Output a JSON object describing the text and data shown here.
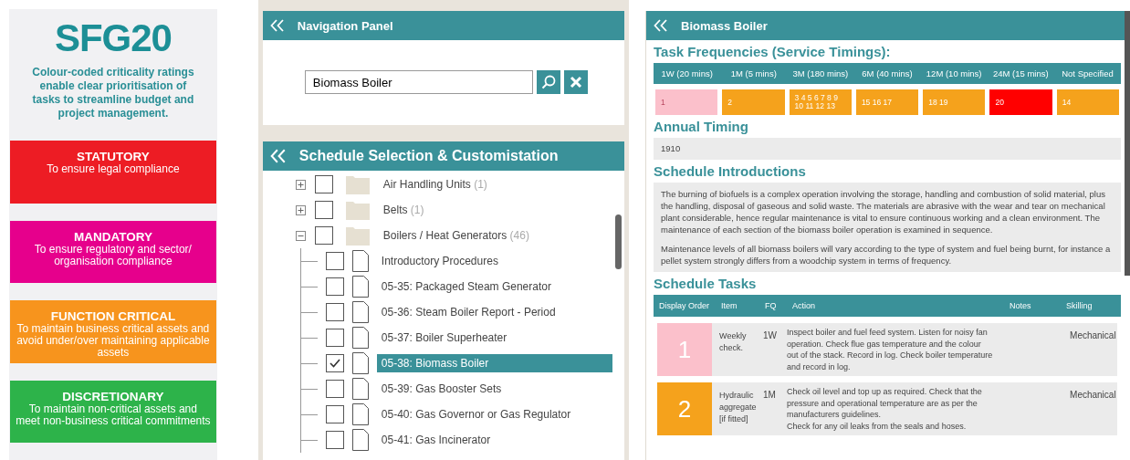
{
  "promo": {
    "logo": "SFG20",
    "tagline": "Colour-coded criticality ratings enable clear prioritisation of tasks to streamline budget and project management.",
    "ratings": [
      {
        "title": "STATUTORY",
        "text": "To ensure legal compliance",
        "color": "#ed1c24"
      },
      {
        "title": "MANDATORY",
        "text": "To ensure regulatory and sector/ organisation compliance",
        "color": "#e6008c"
      },
      {
        "title": "FUNCTION CRITICAL",
        "text": "To maintain business critical assets and avoid under/over maintaining applicable assets",
        "color": "#f7941d"
      },
      {
        "title": "DISCRETIONARY",
        "text": "To maintain non-critical assets and meet non-business critical commitments",
        "color": "#2db34a"
      }
    ]
  },
  "navigation_panel": {
    "title": "Navigation Panel",
    "search": {
      "value": "Biomass Boiler"
    }
  },
  "schedule_panel": {
    "title": "Schedule Selection & Customistation",
    "tree": [
      {
        "label": "Air Handling Units",
        "count": "(1)",
        "expanded": false,
        "checked": false,
        "selected": false
      },
      {
        "label": "Belts",
        "count": "(1)",
        "expanded": false,
        "checked": false,
        "selected": false
      },
      {
        "label": "Boilers / Heat Generators",
        "count": "(46)",
        "expanded": true,
        "checked": false,
        "selected": false,
        "children": [
          {
            "label": "Introductory Procedures",
            "checked": false,
            "selected": false
          },
          {
            "label": "05-35: Packaged Steam Generator",
            "checked": false,
            "selected": false
          },
          {
            "label": "05-36: Steam Boiler Report - Period",
            "checked": false,
            "selected": false
          },
          {
            "label": "05-37: Boiler Superheater",
            "checked": false,
            "selected": false
          },
          {
            "label": "05-38: Biomass Boiler",
            "checked": true,
            "selected": true
          },
          {
            "label": "05-39: Gas Booster Sets",
            "checked": false,
            "selected": false
          },
          {
            "label": "05-40: Gas Governor or Gas Regulator",
            "checked": false,
            "selected": false
          },
          {
            "label": "05-41: Gas Incinerator",
            "checked": false,
            "selected": false
          }
        ]
      }
    ]
  },
  "detail_panel": {
    "title": "Biomass Boiler",
    "frequencies_heading": "Task Frequencies (Service Timings):",
    "frequencies": [
      {
        "label": "1W (20 mins)",
        "tasks": "1",
        "color": "#fbc0cb"
      },
      {
        "label": "1M (5 mins)",
        "tasks": "2",
        "color": "#f5a21c"
      },
      {
        "label": "3M (180 mins)",
        "tasks": "3 4 5 6 7 8 9 10 11 12 13",
        "color": "#f5a21c"
      },
      {
        "label": "6M (40 mins)",
        "tasks": "15 16 17",
        "color": "#f5a21c"
      },
      {
        "label": "12M (10 mins)",
        "tasks": "18 19",
        "color": "#f5a21c"
      },
      {
        "label": "24M (15 mins)",
        "tasks": "20",
        "color": "#ff0000"
      },
      {
        "label": "Not Specified",
        "tasks": "14",
        "color": "#f5a21c"
      }
    ],
    "annual_heading": "Annual Timing",
    "annual_timing": "1910",
    "introductions_heading": "Schedule Introductions",
    "introductions": [
      "The burning of biofuels is a complex operation involving the storage, handling and combustion of solid material, plus the handling, disposal of gaseous and solid waste. The materials are abrasive with the wear and tear on mechanical plant considerable, hence regular maintenance is vital to ensure continuous working and a clean environment. The maintenance of each section of the biomass boiler operation is examined in sequence.",
      "Maintenance levels of all biomass boilers will vary according to the type of system and fuel being burnt, for instance a pellet system strongly differs from a woodchip system in terms of frequency."
    ],
    "tasks_heading": "Schedule Tasks",
    "task_columns": [
      "Display Order",
      "Item",
      "FQ",
      "Action",
      "Notes",
      "Skilling"
    ],
    "tasks": [
      {
        "order": "1",
        "color": "#fbc0cb",
        "item": "Weekly check.",
        "fq": "1W",
        "action": [
          "Inspect boiler and fuel feed system. Listen for noisy fan operation. Check flue gas temperature and the colour out of the stack. Record in log. Check boiler temperature and record in log."
        ],
        "skilling": "Mechanical"
      },
      {
        "order": "2",
        "color": "#f5a21c",
        "item": "Hydraulic aggregate [if fitted]",
        "fq": "1M",
        "action": [
          "Check oil level and top up as required. Check that the pressure and operational temperature are as per the manufacturers guidelines.",
          "Check for any oil leaks from the seals and hoses."
        ],
        "skilling": "Mechanical"
      }
    ]
  }
}
